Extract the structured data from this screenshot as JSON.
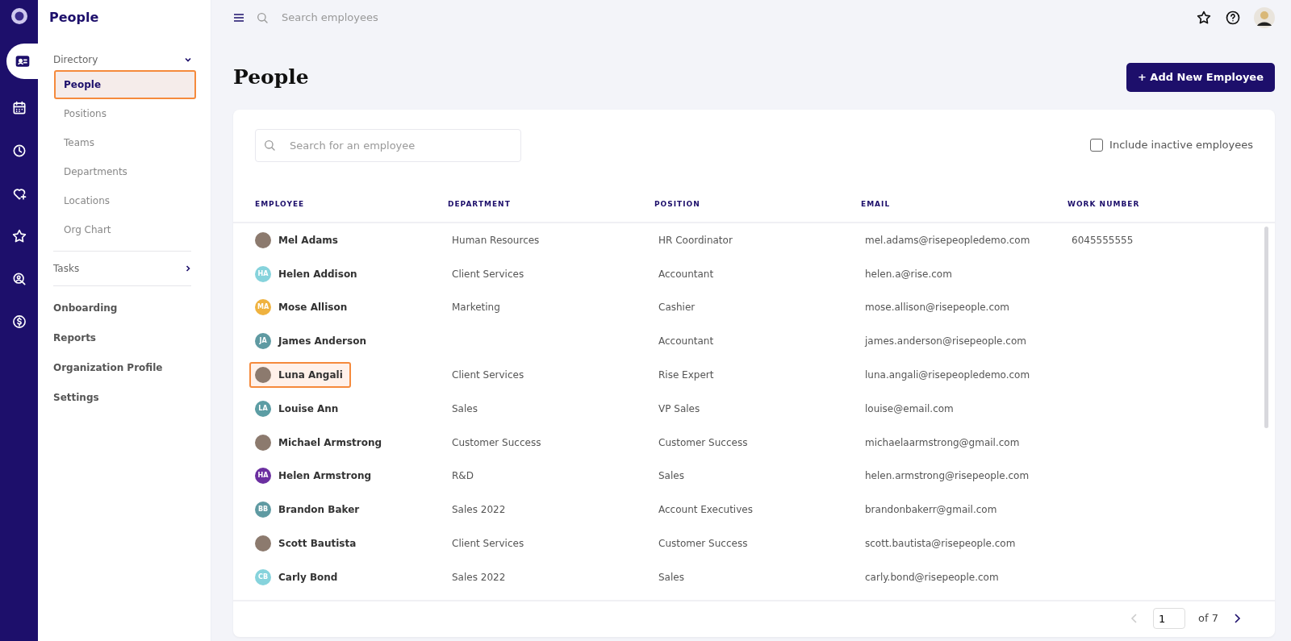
{
  "rail": {
    "items": [
      {
        "selected": true
      },
      {
        "selected": false
      },
      {
        "selected": false
      },
      {
        "selected": false
      },
      {
        "selected": false
      },
      {
        "selected": false
      },
      {
        "selected": false
      }
    ]
  },
  "sidebar": {
    "title": "People",
    "groups": [
      {
        "label": "Directory",
        "expanded": true,
        "children": [
          {
            "label": "People",
            "selected": true,
            "highlighted": true
          },
          {
            "label": "Positions",
            "selected": false,
            "highlighted": false
          },
          {
            "label": "Teams",
            "selected": false,
            "highlighted": false
          },
          {
            "label": "Departments",
            "selected": false,
            "highlighted": false
          },
          {
            "label": "Locations",
            "selected": false,
            "highlighted": false
          },
          {
            "label": "Org Chart",
            "selected": false,
            "highlighted": false
          }
        ]
      },
      {
        "label": "Tasks",
        "expanded": false
      }
    ],
    "links": [
      "Onboarding",
      "Reports",
      "Organization Profile",
      "Settings"
    ]
  },
  "topbar": {
    "search_placeholder": "Search employees"
  },
  "page": {
    "title": "People",
    "add_button": "+ Add New Employee"
  },
  "filter": {
    "search_placeholder": "Search for an employee",
    "include_inactive": {
      "label": "Include inactive employees",
      "checked": false
    }
  },
  "table": {
    "columns": [
      "EMPLOYEE",
      "DEPARTMENT",
      "POSITION",
      "EMAIL",
      "WORK NUMBER"
    ],
    "rows": [
      {
        "avatar": {
          "kind": "photo"
        },
        "name": "Mel Adams",
        "department": "Human Resources",
        "position": "HR Coordinator",
        "email": "mel.adams@risepeopledemo.com",
        "work_number": "6045555555",
        "highlighted": false
      },
      {
        "avatar": {
          "kind": "initials",
          "initials": "HA",
          "color": "#86d3dc"
        },
        "name": "Helen Addison",
        "department": "Client Services",
        "position": "Accountant",
        "email": "helen.a@rise.com",
        "highlighted": false
      },
      {
        "avatar": {
          "kind": "initials",
          "initials": "MA",
          "color": "#efb23f"
        },
        "name": "Mose Allison",
        "department": "Marketing",
        "position": "Cashier",
        "email": "mose.allison@risepeople.com",
        "highlighted": false
      },
      {
        "avatar": {
          "kind": "initials",
          "initials": "JA",
          "color": "#5f9aa2"
        },
        "name": "James Anderson",
        "position": "Accountant",
        "email": "james.anderson@risepeople.com",
        "highlighted": false
      },
      {
        "avatar": {
          "kind": "photo"
        },
        "name": "Luna Angali",
        "department": "Client Services",
        "position": "Rise Expert",
        "email": "luna.angali@risepeopledemo.com",
        "highlighted": true
      },
      {
        "avatar": {
          "kind": "initials",
          "initials": "LA",
          "color": "#5c9da4"
        },
        "name": "Louise Ann",
        "department": "Sales",
        "position": "VP Sales",
        "email": "louise@email.com",
        "highlighted": false
      },
      {
        "avatar": {
          "kind": "photo"
        },
        "name": "Michael Armstrong",
        "department": "Customer Success",
        "position": "Customer Success",
        "email": "michaelaarmstrong@gmail.com",
        "highlighted": false
      },
      {
        "avatar": {
          "kind": "initials",
          "initials": "HA",
          "color": "#6b2fa0"
        },
        "name": "Helen Armstrong",
        "department": "R&D",
        "position": "Sales",
        "email": "helen.armstrong@risepeople.com",
        "highlighted": false
      },
      {
        "avatar": {
          "kind": "initials",
          "initials": "BB",
          "color": "#5f9aa2"
        },
        "name": "Brandon Baker",
        "department": "Sales 2022",
        "position": "Account Executives",
        "email": "brandonbakerr@gmail.com",
        "highlighted": false
      },
      {
        "avatar": {
          "kind": "photo"
        },
        "name": "Scott Bautista",
        "department": "Client Services",
        "position": "Customer Success",
        "email": "scott.bautista@risepeople.com",
        "highlighted": false
      },
      {
        "avatar": {
          "kind": "initials",
          "initials": "CB",
          "color": "#86d3dc"
        },
        "name": "Carly Bond",
        "department": "Sales 2022",
        "position": "Sales",
        "email": "carly.bond@risepeople.com",
        "highlighted": false
      }
    ]
  },
  "pagination": {
    "page": "1",
    "of": "of 7",
    "prev_disabled": true
  }
}
